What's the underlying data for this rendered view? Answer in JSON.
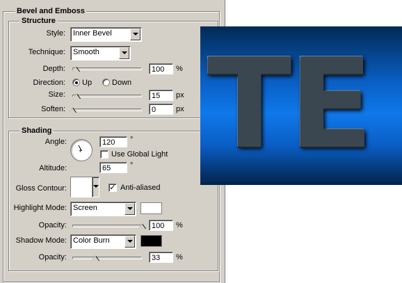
{
  "panel": {
    "title": "Bevel and Emboss"
  },
  "structure": {
    "title": "Structure",
    "style": {
      "label": "Style:",
      "value": "Inner Bevel"
    },
    "technique": {
      "label": "Technique:",
      "value": "Smooth"
    },
    "depth": {
      "label": "Depth:",
      "value": "100",
      "unit": "%",
      "level": 0.05
    },
    "direction": {
      "label": "Direction:",
      "up": "Up",
      "down": "Down",
      "selected": "Up"
    },
    "size": {
      "label": "Size:",
      "value": "15",
      "unit": "px",
      "level": 0.06
    },
    "soften": {
      "label": "Soften:",
      "value": "0",
      "unit": "px",
      "level": 0.0
    }
  },
  "shading": {
    "title": "Shading",
    "angle": {
      "label": "Angle:",
      "value": "120",
      "unit": "°"
    },
    "global_light": {
      "label": "Use Global Light",
      "checked": false
    },
    "altitude": {
      "label": "Altitude:",
      "value": "65",
      "unit": "°"
    },
    "gloss_contour": {
      "label": "Gloss Contour:"
    },
    "anti_aliased": {
      "label": "Anti-aliased",
      "checked": true,
      "mark": "✓"
    },
    "highlight_mode": {
      "label": "Highlight Mode:",
      "value": "Screen",
      "color": "#ffffff"
    },
    "highlight_opacity": {
      "label": "Opacity:",
      "value": "100",
      "unit": "%",
      "level": 1.0
    },
    "shadow_mode": {
      "label": "Shadow Mode:",
      "value": "Color Burn",
      "color": "#000000"
    },
    "shadow_opacity": {
      "label": "Opacity:",
      "value": "33",
      "unit": "%",
      "level": 0.33
    }
  },
  "preview": {
    "text": "TE"
  },
  "colors": {
    "panel_bg": "#d4d0c8",
    "preview_bg": "#0f78ea",
    "letters": "#3a4650"
  },
  "icons": {
    "dropdown": "chevron-down-icon",
    "angle_dial": "angle-dial-icon"
  }
}
